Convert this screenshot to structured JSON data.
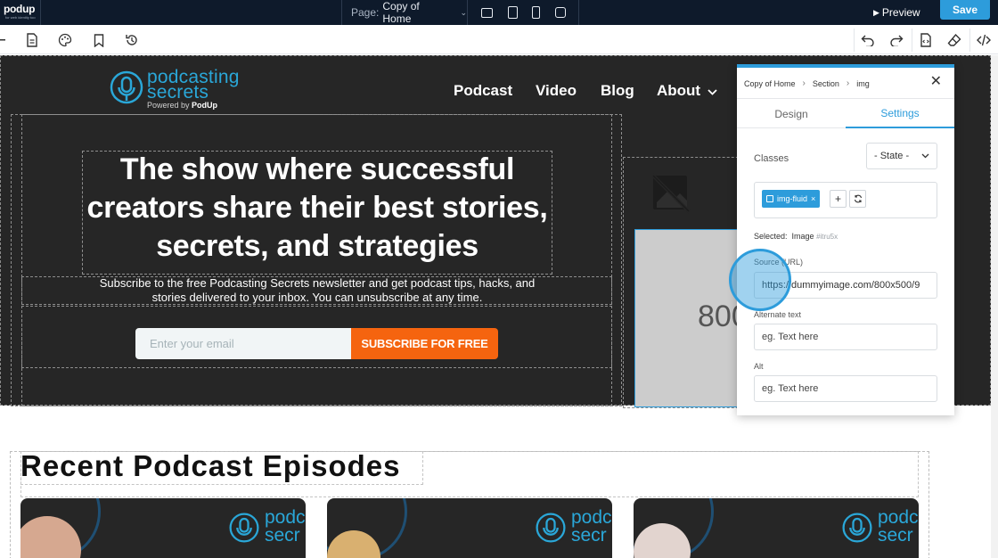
{
  "topbar": {
    "logo_text": "podup",
    "logo_tagline": "for web identity too",
    "page_label": "Page:",
    "page_name": "Copy of Home",
    "preview_label": "Preview",
    "save_label": "Save"
  },
  "toolbar": {
    "left_icons": [
      "drag-handle-icon",
      "page-icon",
      "palette-icon",
      "bookmark-icon",
      "history-icon"
    ],
    "right_icons": [
      "undo-icon",
      "redo-icon",
      "code-file-icon",
      "eraser-icon",
      "code-icon"
    ]
  },
  "site": {
    "brand_line1": "podcasting",
    "brand_line2": "secrets",
    "powered_prefix": "Powered by ",
    "powered_brand": "PodUp",
    "nav": [
      {
        "label": "Podcast"
      },
      {
        "label": "Video"
      },
      {
        "label": "Blog"
      },
      {
        "label": "About"
      }
    ],
    "hero_title": "The show where successful creators share their best stories, secrets, and strategies",
    "hero_subtitle": "Subscribe to the free Podcasting Secrets newsletter and get podcast tips, hacks, and stories delivered to your inbox. You can unsubscribe at any time.",
    "email_placeholder": "Enter your email",
    "subscribe_label": "SUBSCRIBE FOR FREE",
    "image_placeholder_text": "800",
    "episodes_title": "Recent Podcast Episodes",
    "card_logo_line1": "podc",
    "card_logo_line2": "secr"
  },
  "panel": {
    "breadcrumb": [
      "Copy of Home",
      "Section",
      "img"
    ],
    "tabs": [
      {
        "label": "Design"
      },
      {
        "label": "Settings"
      }
    ],
    "active_tab": "Settings",
    "classes_label": "Classes",
    "state_value": "- State -",
    "class_chip": "img-fluid",
    "selected_label": "Selected:",
    "selected_type": "Image",
    "selected_id": "#itru5x",
    "source_label": "Source (URL)",
    "source_value": "https://dummyimage.com/800x500/9",
    "alt_text_label": "Alternate text",
    "alt_text_placeholder": "eg. Text here",
    "alt_label": "Alt",
    "alt_placeholder": "eg. Text here"
  },
  "colors": {
    "topbar_bg": "#0e1a2b",
    "accent": "#2d9cdb",
    "subscribe": "#f5640f",
    "hero_bg": "#262626",
    "brand_blue": "#2aa7d8"
  }
}
